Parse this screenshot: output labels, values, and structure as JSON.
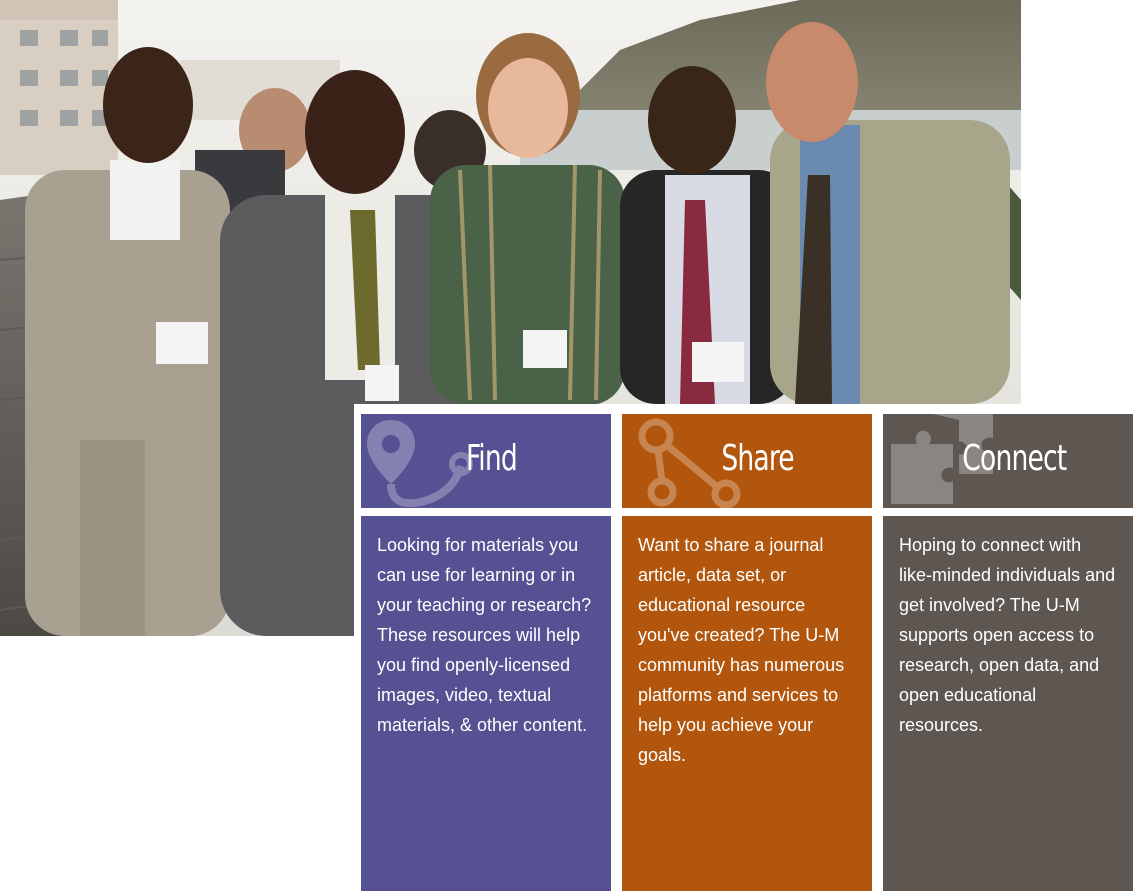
{
  "hero": {
    "alt_icon": "group-photo"
  },
  "cards": [
    {
      "id": "find",
      "title": "Find",
      "icon": "map-pin-route-icon",
      "color": "#555192",
      "text": "Looking for materials you can use for learning or in your teaching or research? These resources will help you find openly-licensed images, video, textual materials, & other content."
    },
    {
      "id": "share",
      "title": "Share",
      "icon": "share-nodes-icon",
      "color": "#b2560e",
      "text": "Want to share a journal article, data set, or educational resource you've created? The U-M community has numerous platforms and services to help you achieve your goals."
    },
    {
      "id": "connect",
      "title": "Connect",
      "icon": "puzzle-pieces-icon",
      "color": "#5e5650",
      "text": "Hoping to connect with like-minded individuals and get involved? The U-M supports open access to research, open data, and open educational resources."
    }
  ]
}
